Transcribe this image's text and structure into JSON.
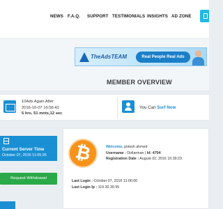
{
  "nav": {
    "items": [
      "NEWS",
      "F.A.Q.",
      "SUPPORT",
      "TESTIMONIALS",
      "INSIGHTS",
      "AD ZONE"
    ]
  },
  "banner": {
    "brand": "TheAdsTEAM",
    "tagline": "Real People Real Ads"
  },
  "overview": {
    "title": "MEMBER OVERVIEW"
  },
  "ads": {
    "line1": "10Ads Again After",
    "line2": "2016-10-07 16:56:42",
    "hours": "5",
    "hours_unit": " hrs, ",
    "minutes": "51",
    "minutes_unit": " mnts,",
    "seconds": "12",
    "seconds_unit": " sec"
  },
  "surf": {
    "prefix": "You Can ",
    "link": "Surf Now"
  },
  "server": {
    "title": "Current Server Time",
    "time": "October 07, 2016 11:05:26"
  },
  "withdraw": {
    "label": "Request Withdrawal"
  },
  "profile": {
    "welcome_label": "Welcome,",
    "welcome_name": " polash ahmed",
    "username_label": "Username :",
    "username": " Dollarman",
    "id_sep": "  |  ",
    "id_label": "Id:",
    "id": " 4704",
    "reg_label": "Registration Date :",
    "reg_date": " August 02, 2016 15:39:23",
    "last_login_label": "Last Login :",
    "last_login": " October 07, 2016 11:00:00",
    "last_ip_label": "Last Login Ip :",
    "last_ip": " 119.30.39.55"
  },
  "colors": {
    "accent": "#1a8fd3",
    "button_green": "#2aa948",
    "bitcoin": "#f7931a"
  },
  "icons": {
    "corner": "toolbar-tab-icon",
    "ads": "calendar-icon",
    "surf": "person-icon",
    "server": "server-icon",
    "avatar": "bitcoin-icon"
  }
}
